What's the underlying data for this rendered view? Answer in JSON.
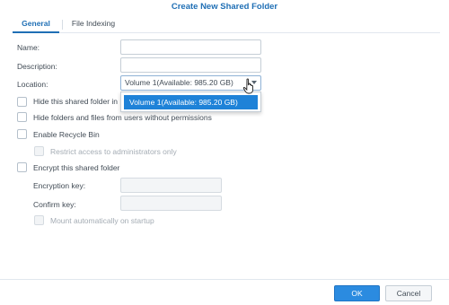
{
  "dialog": {
    "title": "Create New Shared Folder"
  },
  "tabs": [
    {
      "label": "General",
      "active": true
    },
    {
      "label": "File Indexing",
      "active": false
    }
  ],
  "form": {
    "name_label": "Name:",
    "name_value": "",
    "description_label": "Description:",
    "description_value": "",
    "location_label": "Location:",
    "location_value": "Volume 1(Available: 985.20 GB)",
    "location_options": [
      "Volume 1(Available: 985.20 GB)"
    ]
  },
  "options": {
    "hide_in_network": {
      "label": "Hide this shared folder in",
      "checked": false
    },
    "hide_files_no_perm": {
      "label": "Hide folders and files from users without permissions",
      "checked": false
    },
    "recycle_bin": {
      "label": "Enable Recycle Bin",
      "checked": false
    },
    "restrict_admins": {
      "label": "Restrict access to administrators only",
      "checked": false,
      "disabled": true
    },
    "encrypt": {
      "label": "Encrypt this shared folder",
      "checked": false
    }
  },
  "encryption": {
    "key_label": "Encryption key:",
    "key_value": "",
    "confirm_label": "Confirm key:",
    "confirm_value": "",
    "mount_label": "Mount automatically on startup",
    "mount_checked": false
  },
  "buttons": {
    "ok": "OK",
    "cancel": "Cancel"
  },
  "colors": {
    "accent": "#1f6fb5",
    "selection": "#1e82d8",
    "primary_button": "#2b8be0"
  }
}
